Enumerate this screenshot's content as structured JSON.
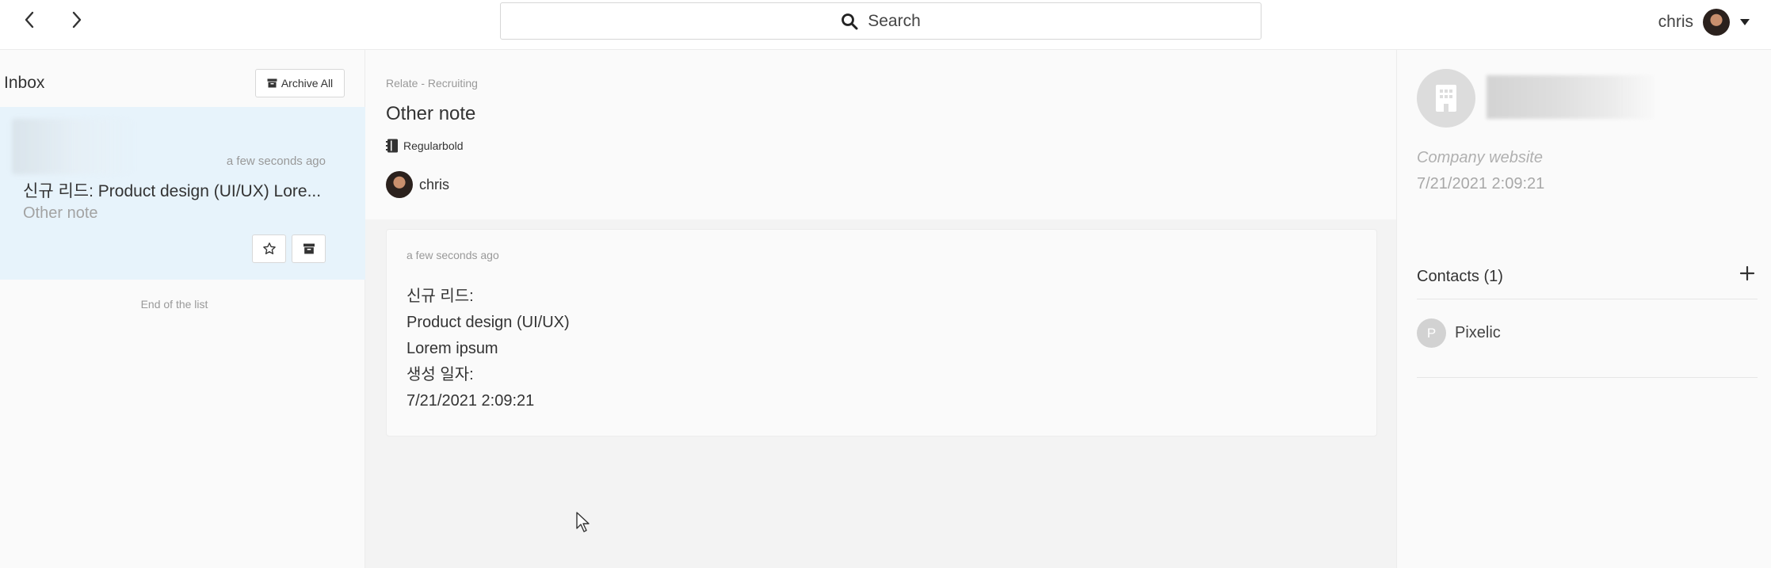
{
  "topbar": {
    "search_label": "Search",
    "user_name": "chris"
  },
  "inbox": {
    "title": "Inbox",
    "archive_all_label": "Archive All",
    "item": {
      "time": "a few seconds ago",
      "title": "신규 리드: Product design (UI/UX) Lore...",
      "subtitle": "Other note"
    },
    "end_label": "End of the list"
  },
  "note": {
    "breadcrumb": "Relate - Recruiting",
    "title": "Other note",
    "tag": "Regularbold",
    "author": "chris",
    "time": "a few seconds ago",
    "lines": [
      "신규 리드:",
      "Product design (UI/UX)",
      "Lorem ipsum",
      "생성 일자:",
      "7/21/2021 2:09:21"
    ]
  },
  "company": {
    "website_placeholder": "Company website",
    "date": "7/21/2021 2:09:21",
    "contacts_title": "Contacts (1)",
    "contacts": [
      {
        "initial": "P",
        "name": "Pixelic"
      }
    ]
  },
  "icons": {
    "back": "chevron-left-icon",
    "forward": "chevron-right-icon",
    "search": "search-icon",
    "dropdown": "caret-down-icon",
    "archive": "archive-box-icon",
    "star": "star-outline-icon",
    "notebook": "notebook-icon",
    "building": "building-icon",
    "plus": "plus-icon",
    "cursor": "mouse-pointer-icon"
  }
}
